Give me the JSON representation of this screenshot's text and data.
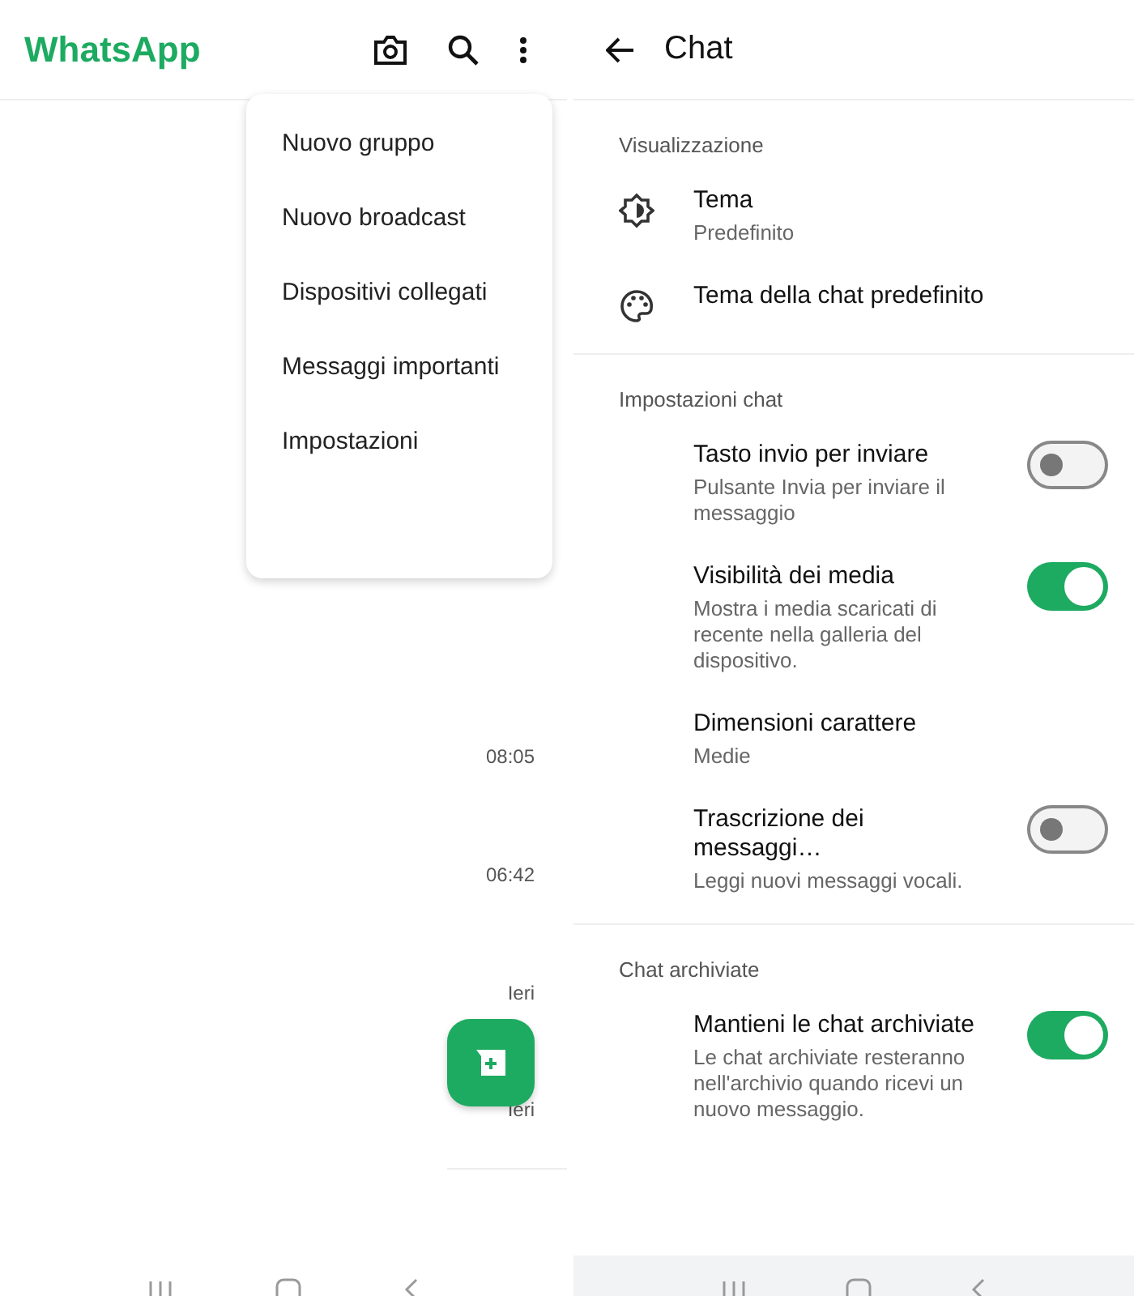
{
  "home": {
    "title": "WhatsApp",
    "menu": [
      {
        "label": "Nuovo gruppo"
      },
      {
        "label": "Nuovo broadcast"
      },
      {
        "label": "Dispositivi collegati"
      },
      {
        "label": "Messaggi importanti"
      },
      {
        "label": "Impostazioni"
      }
    ],
    "times": [
      "08:05",
      "06:42",
      "Ieri",
      "Ieri"
    ]
  },
  "settings": {
    "title": "Chat",
    "sections": [
      {
        "heading": "Visualizzazione",
        "items": [
          {
            "kind": "theme",
            "title": "Tema",
            "subtitle": "Predefinito"
          },
          {
            "kind": "palette",
            "title": "Tema della chat predefinito"
          }
        ]
      },
      {
        "heading": "Impostazioni chat",
        "items": [
          {
            "kind": "toggle",
            "title": "Tasto invio per inviare",
            "subtitle": "Pulsante Invia per inviare il messaggio",
            "on": false
          },
          {
            "kind": "toggle",
            "title": "Visibilità dei media",
            "subtitle": "Mostra i media scaricati di recente nella galleria del dispositivo.",
            "on": true
          },
          {
            "kind": "plain",
            "title": "Dimensioni carattere",
            "subtitle": "Medie"
          },
          {
            "kind": "toggle",
            "title": "Trascrizione dei messaggi…",
            "subtitle": "Leggi nuovi messaggi vocali.",
            "on": false
          }
        ]
      },
      {
        "heading": "Chat archiviate",
        "items": [
          {
            "kind": "toggle",
            "title": "Mantieni le chat archiviate",
            "subtitle": "Le chat archiviate resteranno nell'archivio quando ricevi un nuovo messaggio.",
            "on": true
          }
        ]
      }
    ]
  }
}
